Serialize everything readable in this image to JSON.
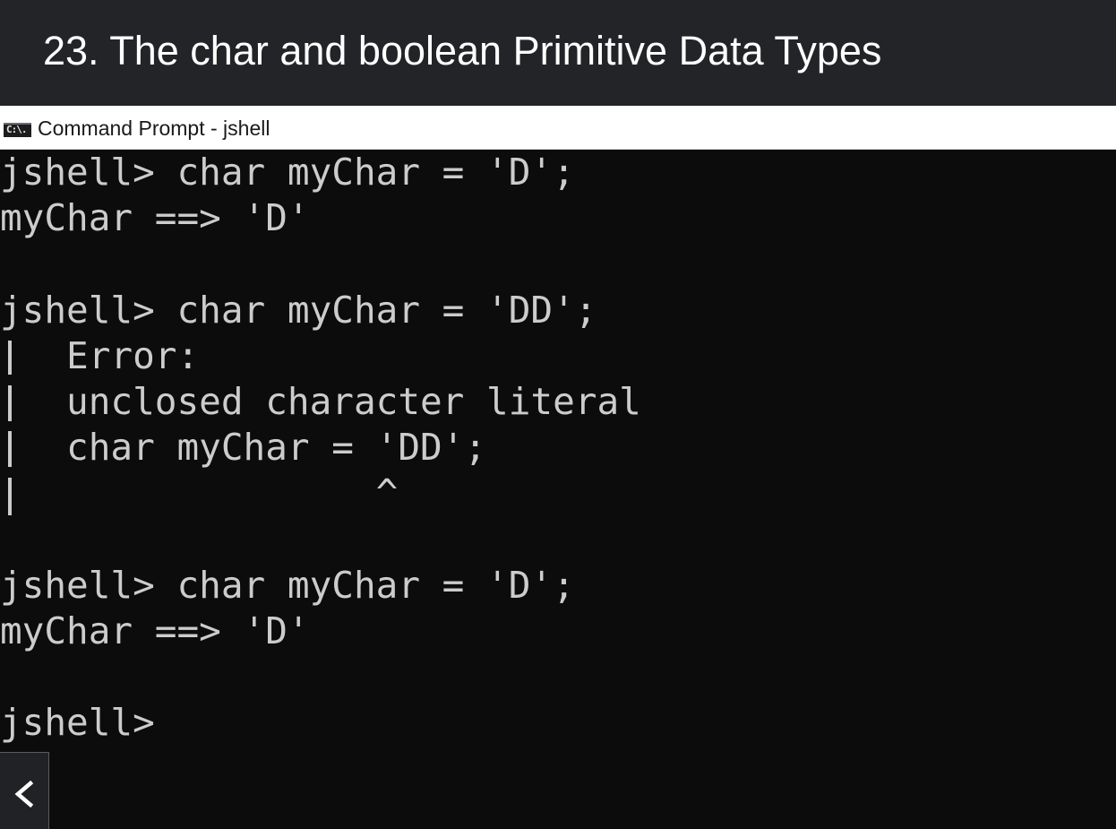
{
  "header": {
    "title": "23. The char and boolean Primitive Data Types"
  },
  "window": {
    "icon": "cmd-icon",
    "icon_text": "C:\\.",
    "title": "Command Prompt - jshell"
  },
  "terminal": {
    "lines": [
      "jshell> char myChar = 'D';",
      "myChar ==> 'D'",
      "",
      "jshell> char myChar = 'DD';",
      "   Error:",
      "   unclosed character literal",
      "   char myChar = 'DD';",
      "                 ^",
      "",
      "jshell> char myChar = 'D';",
      "myChar ==> 'D'",
      "",
      "jshell>"
    ]
  },
  "nav": {
    "back_icon": "chevron-left-icon"
  },
  "colors": {
    "header_bg": "#232427",
    "terminal_bg": "#0c0c0c",
    "terminal_text": "#cccccc"
  }
}
